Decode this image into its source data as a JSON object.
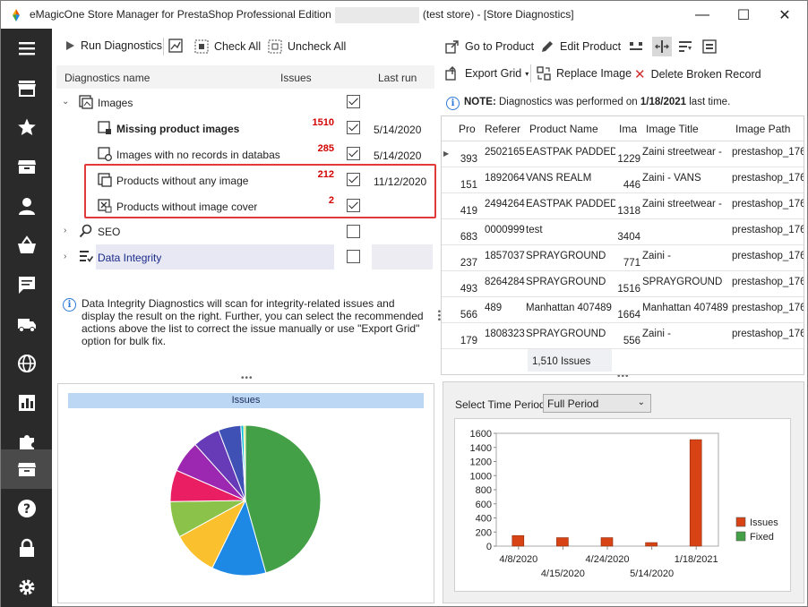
{
  "window": {
    "title_prefix": "eMagicOne Store Manager for PrestaShop Professional Edition",
    "title_suffix": "(test store) - [Store Diagnostics]",
    "minimize": "—",
    "maximize": "☐",
    "close": "✕"
  },
  "sidebar": {
    "items": [
      "menu-icon",
      "store-icon",
      "star-icon",
      "box-icon",
      "user-icon",
      "basket-icon",
      "chat-icon",
      "truck-icon",
      "globe-icon",
      "chart-icon",
      "puzzle-icon",
      "archive-icon",
      "help-icon",
      "lock-icon",
      "gear-icon"
    ],
    "active_index": 11
  },
  "left_toolbar": {
    "run": "Run Diagnostics",
    "check_all": "Check All",
    "uncheck_all": "Uncheck All"
  },
  "tree": {
    "col_name": "Diagnostics name",
    "col_issues": "Issues",
    "col_last_run": "Last run",
    "rows": [
      {
        "label": "Images",
        "count": "",
        "date": "",
        "checked": true,
        "level": 0
      },
      {
        "label": "Missing product images",
        "count": "1510",
        "date": "5/14/2020",
        "checked": true,
        "level": 1
      },
      {
        "label": "Images with no records in databas",
        "count": "285",
        "date": "5/14/2020",
        "checked": true,
        "level": 1
      },
      {
        "label": "Products without any image",
        "count": "212",
        "date": "11/12/2020",
        "checked": true,
        "level": 1
      },
      {
        "label": "Products without image cover",
        "count": "2",
        "date": "",
        "checked": true,
        "level": 1
      },
      {
        "label": "SEO",
        "count": "",
        "date": "",
        "checked": false,
        "level": 0
      },
      {
        "label": "Data Integrity",
        "count": "",
        "date": "",
        "checked": false,
        "level": 0
      }
    ]
  },
  "info": {
    "text": "Data Integrity Diagnostics will scan for integrity-related issues and display the result on the right. Further, you can select the recommended actions above the list to correct the issue manually or use \"Export Grid\" option for bulk fix."
  },
  "right_toolbar": {
    "goto_product": "Go to Product",
    "edit_product": "Edit Product",
    "export_grid": "Export Grid",
    "replace_image": "Replace Image",
    "delete_broken": "Delete Broken Record"
  },
  "notice": {
    "bold": "NOTE:",
    "text1": "Diagnostics was performed on",
    "date": "1/18/2021",
    "text2": "last time."
  },
  "grid": {
    "headers": [
      "Pro",
      "Referer",
      "Product Name",
      "Ima",
      "Image Title",
      "Image Path"
    ],
    "rows": [
      [
        "393",
        "2502165",
        "EASTPAK PADDED",
        "1229",
        "Zaini streetwear -",
        "prestashop_176"
      ],
      [
        "151",
        "1892064",
        "VANS REALM",
        "446",
        "Zaini - VANS",
        "prestashop_176"
      ],
      [
        "419",
        "2494264",
        "EASTPAK PADDED",
        "1318",
        "Zaini streetwear -",
        "prestashop_176"
      ],
      [
        "683",
        "0000999",
        "test",
        "3404",
        "",
        "prestashop_176"
      ],
      [
        "237",
        "1857037",
        "SPRAYGROUND",
        "771",
        "Zaini -",
        "prestashop_176"
      ],
      [
        "493",
        "8264284",
        "SPRAYGROUND",
        "1516",
        "SPRAYGROUND",
        "prestashop_176"
      ],
      [
        "566",
        "489",
        "Manhattan 407489",
        "1664",
        "Manhattan 407489",
        "prestashop_176"
      ],
      [
        "179",
        "1808323",
        "SPRAYGROUND",
        "556",
        "Zaini -",
        "prestashop_176"
      ]
    ],
    "footer": "1,510 Issues"
  },
  "period": {
    "label": "Select Time Period",
    "value": "Full Period"
  },
  "chart_data": [
    {
      "type": "pie",
      "title": "Issues",
      "values": [
        47,
        12,
        10,
        8,
        7,
        7,
        6,
        5,
        0.6,
        0.4
      ],
      "colors": [
        "#43a047",
        "#1e88e5",
        "#fbc02d",
        "#8bc34a",
        "#e91e63",
        "#9c27b0",
        "#673ab7",
        "#3f51b5",
        "#00bcd4",
        "#cddc39"
      ]
    },
    {
      "type": "bar",
      "categories": [
        "4/8/2020",
        "4/15/2020",
        "4/24/2020",
        "5/14/2020",
        "1/18/2021"
      ],
      "series": [
        {
          "name": "Issues",
          "values": [
            150,
            120,
            120,
            50,
            1510
          ],
          "color": "#d84315"
        },
        {
          "name": "Fixed",
          "values": [
            0,
            0,
            0,
            0,
            0
          ],
          "color": "#43a047"
        }
      ],
      "ylim": [
        0,
        1600
      ],
      "yticks": [
        0,
        200,
        400,
        600,
        800,
        1000,
        1200,
        1400,
        1600
      ],
      "legend": "right"
    }
  ]
}
